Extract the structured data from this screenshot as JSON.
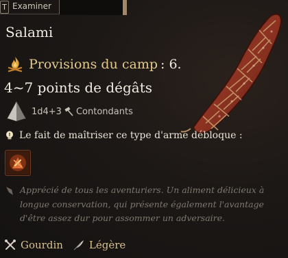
{
  "topbar": {
    "key": "T",
    "action": "Examiner"
  },
  "item": {
    "name": "Salami",
    "camp_label": "Provisions du camp",
    "camp_value": ": 6.",
    "damage": "4~7 points de dégâts",
    "dice": "1d4+3",
    "damage_type": "Contondants",
    "unlock_text": "Le fait de maîtriser ce type d'arme débloque :",
    "description": "Apprécié de tous les aventuriers. Un aliment délicieux à longue conservation, qui présente également l'avantage d'être assez dur pour assommer un adversaire.",
    "properties": [
      {
        "label": "Gourdin",
        "icon": "crossed-clubs-icon"
      },
      {
        "label": "Légère",
        "icon": "feather-icon"
      }
    ]
  },
  "icons": {
    "camp": "campfire-icon",
    "dice": "d4-dice-icon",
    "damage_type": "hammer-icon",
    "unlock": "lightbulb-icon",
    "ability": "weapon-action-icon",
    "description": "quill-icon"
  },
  "colors": {
    "background": "#1c1816",
    "camp_label": "#e2c98f",
    "property_label": "#d8c08a",
    "description": "#7f7870"
  }
}
